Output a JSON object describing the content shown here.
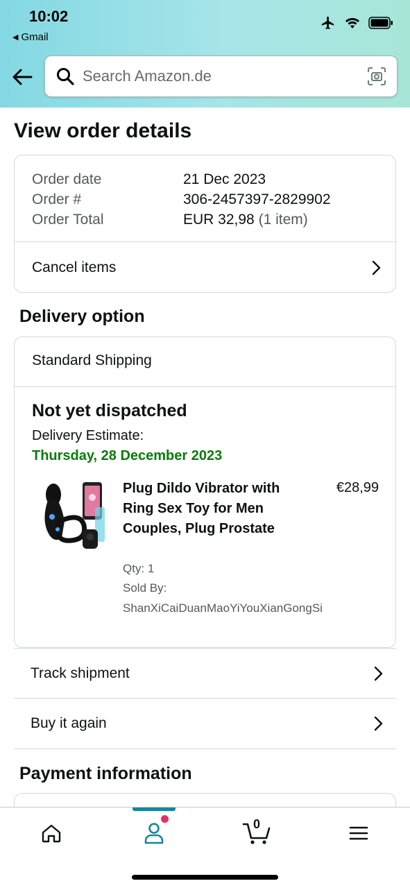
{
  "status_bar": {
    "time": "10:02",
    "back_app": "Gmail"
  },
  "search": {
    "placeholder": "Search Amazon.de"
  },
  "page_title": "View order details",
  "order_summary": {
    "rows": [
      {
        "label": "Order date",
        "value": "21 Dec 2023"
      },
      {
        "label": "Order #",
        "value": "306-2457397-2829902"
      },
      {
        "label": "Order Total",
        "value": "EUR 32,98",
        "extra": "(1 item)"
      }
    ],
    "cancel_label": "Cancel items"
  },
  "delivery": {
    "section_title": "Delivery option",
    "method": "Standard Shipping",
    "status": "Not yet dispatched",
    "estimate_label": "Delivery Estimate:",
    "estimate_date": "Thursday, 28 December 2023",
    "accent_color": "#067d06",
    "product": {
      "title": "Plug Dildo Vibrator with Ring Sex Toy for Men Couples, Plug Prostate",
      "price": "€28,99",
      "qty": "Qty: 1",
      "sold_by_label": "Sold By:",
      "seller": "ShanXiCaiDuanMaoYiYouXianGongSi"
    }
  },
  "actions": {
    "track": "Track shipment",
    "buy_again": "Buy it again"
  },
  "payment": {
    "section_title": "Payment information"
  },
  "tabbar": {
    "items": [
      {
        "name": "home",
        "icon": "home-icon"
      },
      {
        "name": "account",
        "icon": "person-icon",
        "active": true
      },
      {
        "name": "cart",
        "icon": "cart-icon",
        "count": "0"
      },
      {
        "name": "menu",
        "icon": "menu-icon"
      }
    ],
    "active_color": "#16879b",
    "notification_color": "#e3325f"
  }
}
